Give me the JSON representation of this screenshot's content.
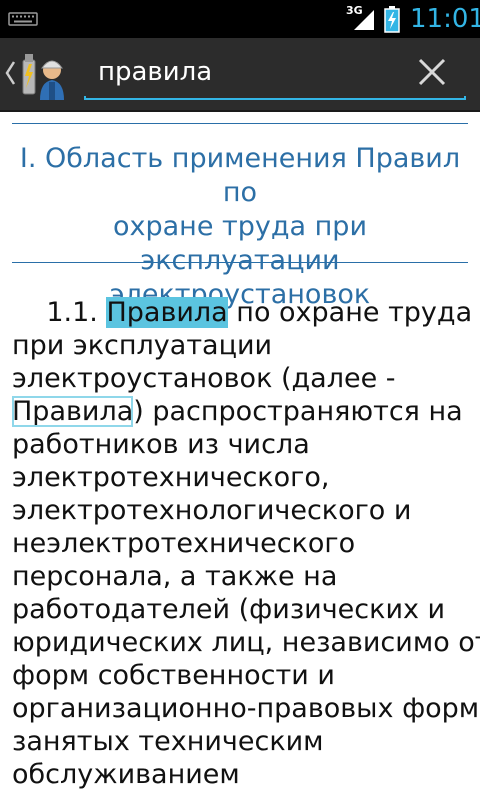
{
  "status_bar": {
    "network_label": "3G",
    "time": "11:01"
  },
  "action_bar": {
    "search_value": "правила"
  },
  "document": {
    "section_title_lines": [
      "I. Область применения Правил по",
      "охране труда при эксплуатации",
      "электроустановок"
    ],
    "paragraph": {
      "l1_prefix": "1.1. ",
      "l1_match": "Правила",
      "l1_rest": " по охране труда",
      "l2": "при эксплуатации",
      "l3": "электроустановок (далее -",
      "l4_match": "Правила",
      "l4_rest": ") распространяются на",
      "l5": "работников из числа",
      "l6": "электротехнического,",
      "l7": "электротехнологического и",
      "l8": "неэлектротехнического",
      "l9": "персонала, а также на",
      "l10": "работодателей (физических и",
      "l11": "юридических лиц, независимо от",
      "l12": "форм собственности и",
      "l13": "организационно-правовых форм),",
      "l14": "занятых техническим",
      "l15": "обслуживанием"
    }
  },
  "colors": {
    "accent": "#33b5e5",
    "title_blue": "#2c6fa6",
    "highlight_current": "#5bc4e0",
    "action_bar_bg": "#2c2c2c"
  },
  "icons": {
    "keyboard": "keyboard-icon",
    "signal": "signal-icon",
    "battery": "battery-charging-icon",
    "back": "chevron-left-icon",
    "logo": "electrician-logo-icon",
    "clear": "close-icon"
  }
}
